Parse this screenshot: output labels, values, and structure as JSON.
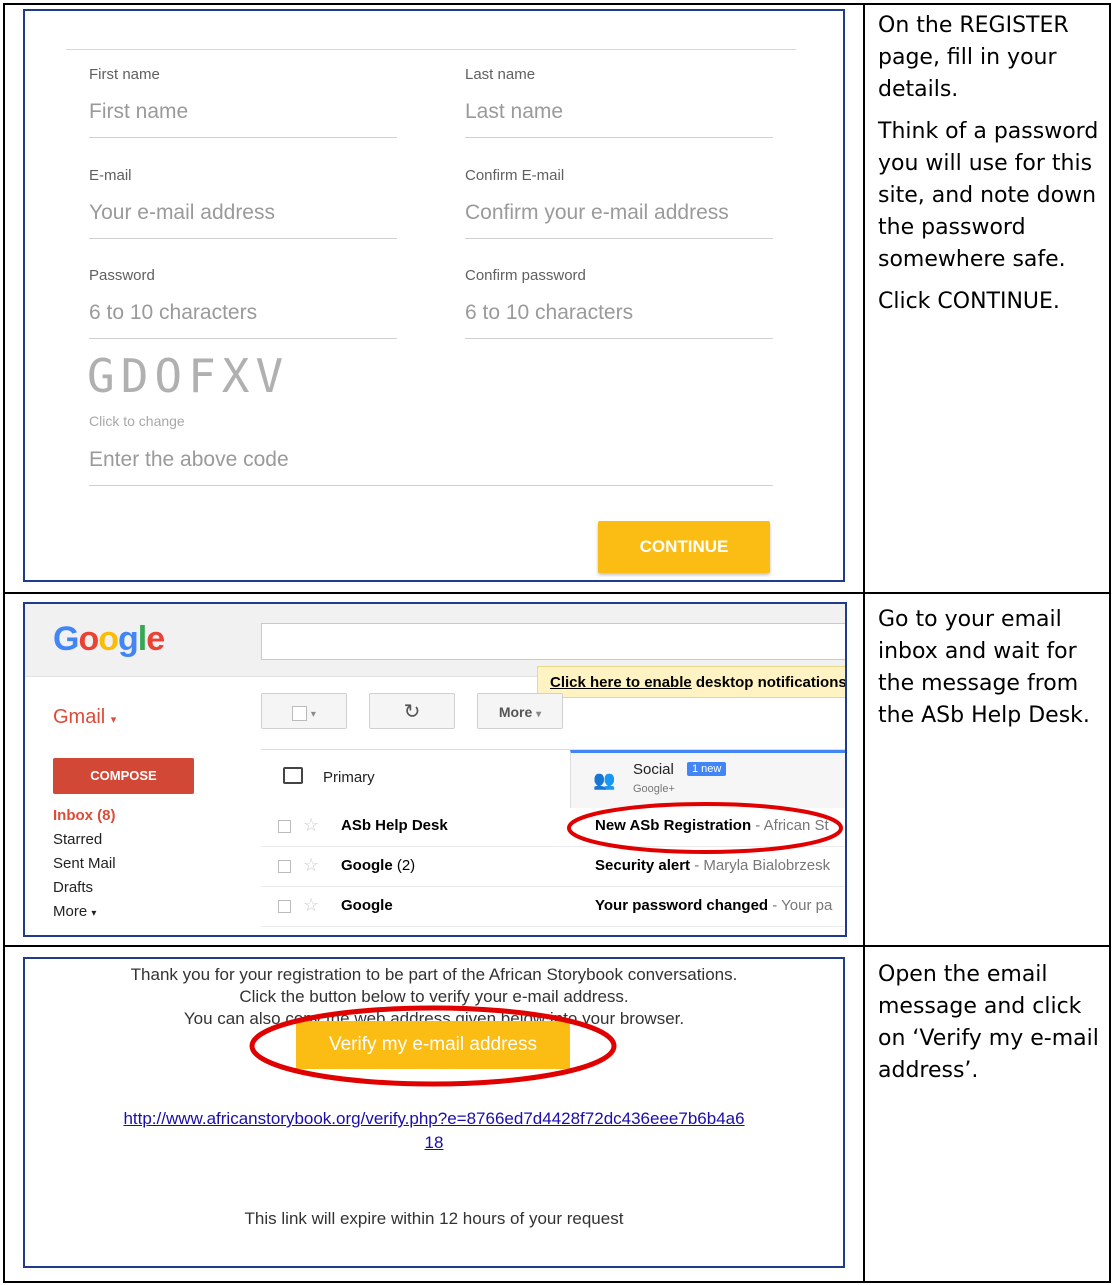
{
  "register_form": {
    "first_name_label": "First name",
    "first_name_placeholder": "First name",
    "last_name_label": "Last name",
    "last_name_placeholder": "Last name",
    "email_label": "E-mail",
    "email_placeholder": "Your e-mail address",
    "confirm_email_label": "Confirm E-mail",
    "confirm_email_placeholder": "Confirm your e-mail address",
    "password_label": "Password",
    "password_placeholder": "6 to 10 characters",
    "confirm_password_label": "Confirm password",
    "confirm_password_placeholder": "6 to 10 characters",
    "captcha_code": "GDOFXV",
    "captcha_hint": "Click to change",
    "code_placeholder": "Enter the above code",
    "continue_label": "CONTINUE"
  },
  "instructions": {
    "step1": [
      "On the REGISTER page, fill in your details.",
      "Think of a password you will use for this site, and note down the password somewhere safe.",
      "Click CONTINUE."
    ],
    "step2": [
      "Go to your email inbox and wait for the message from the ASb Help Desk."
    ],
    "step3": [
      "Open the email message and click on ‘Verify my e-mail address’."
    ]
  },
  "gmail": {
    "logo": "Google",
    "notification_link": "Click here to enable",
    "notification_rest": " desktop notifications",
    "app_title": "Gmail",
    "more_button": "More",
    "refresh_icon": "refresh-icon",
    "compose_label": "COMPOSE",
    "nav": [
      "Inbox (8)",
      "Starred",
      "Sent Mail",
      "Drafts",
      "More"
    ],
    "tab_primary": "Primary",
    "tab_social": "Social",
    "tab_social_badge": "1 new",
    "tab_social_sub": "Google+",
    "rows": [
      {
        "sender": "ASb Help Desk",
        "count": "",
        "subject": "New ASb Registration",
        "snippet": " - African St"
      },
      {
        "sender": "Google",
        "count": " (2)",
        "subject": "Security alert",
        "snippet": " - Maryla Bialobrzesk"
      },
      {
        "sender": "Google",
        "count": "",
        "subject": "Your password changed",
        "snippet": " - Your pa"
      }
    ],
    "highlight_color": "#e00000"
  },
  "verify_email": {
    "line1": "Thank you for your registration to be part of the African Storybook conversations.",
    "line2": "Click the button below to verify your e-mail address.",
    "line3": "You can also copy the web address given below into your browser.",
    "button_label": "Verify my e-mail address",
    "link_line1": "http://www.africanstorybook.org/verify.php?e=8766ed7d4428f72dc436eee7b6b4a6",
    "link_line2": "18",
    "expiry": "This link will expire within 12 hours of your request"
  },
  "colors": {
    "accent_yellow": "#fbbc13",
    "panel_border": "#1f3b8a",
    "gmail_red": "#dd4b39",
    "compose_red": "#d14836"
  }
}
